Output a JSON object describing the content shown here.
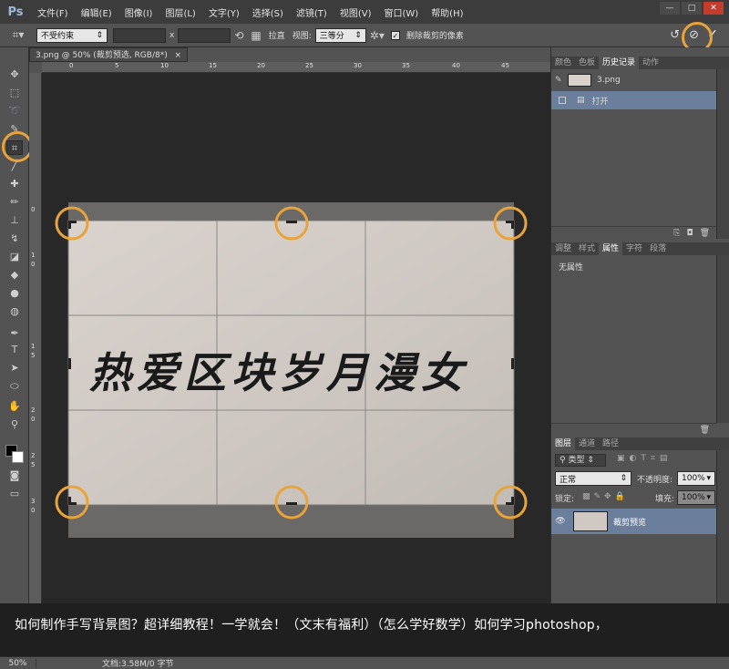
{
  "app": {
    "logo": "Ps",
    "window_controls": [
      "—",
      "□",
      "✕"
    ]
  },
  "menu": [
    "文件(F)",
    "编辑(E)",
    "图像(I)",
    "图层(L)",
    "文字(Y)",
    "选择(S)",
    "滤镜(T)",
    "视图(V)",
    "窗口(W)",
    "帮助(H)"
  ],
  "options": {
    "ratio_select": "不受约束",
    "times_sign": "x",
    "straighten": "拉直",
    "view_label": "视图:",
    "view_select": "三等分",
    "delete_cropped": "删除裁剪的像素",
    "delete_cropped_checked": true
  },
  "document": {
    "tab": "3.png @ 50% (裁剪预选, RGB/8*)",
    "close": "×",
    "zoom": "50%",
    "doc_size": "文档:3.58M/0 字节",
    "ruler_h": [
      "0",
      "5",
      "10",
      "15",
      "20",
      "25",
      "30",
      "35",
      "40",
      "45"
    ],
    "ruler_v": [
      "0",
      "1",
      "0",
      "1",
      "5",
      "2",
      "0",
      "2",
      "5",
      "3",
      "0"
    ],
    "calligraphy": "热爱区块岁月漫女"
  },
  "history_panel": {
    "tabs": [
      "颜色",
      "色板",
      "历史记录",
      "动作"
    ],
    "active_tab": "历史记录",
    "snapshot": "3.png",
    "items": [
      "打开"
    ]
  },
  "properties_panel": {
    "tabs": [
      "调整",
      "样式",
      "属性",
      "字符",
      "段落"
    ],
    "active_tab": "属性",
    "empty_text": "无属性"
  },
  "layers_panel": {
    "tabs": [
      "图层",
      "通道",
      "路径"
    ],
    "active_tab": "图层",
    "filter": "类型",
    "blend_mode": "正常",
    "opacity_label": "不透明度:",
    "opacity": "100%",
    "lock_label": "锁定:",
    "fill_label": "填充:",
    "fill": "100%",
    "layers": [
      {
        "name": "裁剪预览"
      }
    ]
  },
  "banner": {
    "text": "如何制作手写背景图？超详细教程！一学就会！（文末有福利）（怎么学好数学）如何学习photoshop，"
  },
  "colors": {
    "highlight": "#e8a33a",
    "selected_row": "#6b7f9c"
  }
}
